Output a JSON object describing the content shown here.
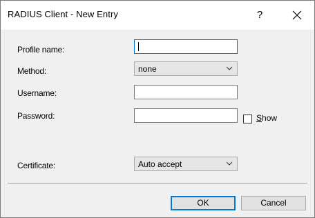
{
  "window": {
    "title": "RADIUS Client - New Entry",
    "help_label": "?"
  },
  "form": {
    "profile_name": {
      "label": "Profile name:",
      "value": ""
    },
    "method": {
      "label": "Method:",
      "selected": "none"
    },
    "username": {
      "label": "Username:",
      "value": ""
    },
    "password": {
      "label": "Password:",
      "value": "",
      "show_label_prefix": "S",
      "show_label_rest": "how",
      "show_checked": false
    },
    "certificate": {
      "label": "Certificate:",
      "selected": "Auto accept"
    }
  },
  "buttons": {
    "ok_label": "OK",
    "cancel_label": "Cancel"
  },
  "colors": {
    "focus_border": "#0078d7",
    "dialog_bg": "#f0f0f0"
  },
  "icons": {
    "close": "close-icon",
    "dropdown": "chevron-down-icon"
  }
}
